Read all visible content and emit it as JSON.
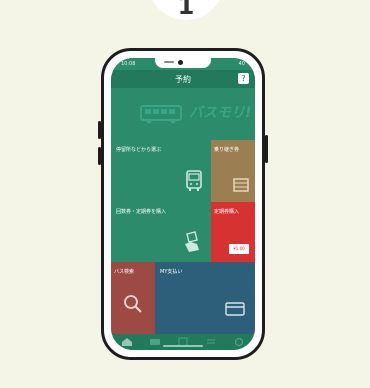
{
  "step": {
    "number": "1"
  },
  "status_bar": {
    "time": "10:08",
    "battery": "40"
  },
  "nav": {
    "title": "予約",
    "help": "?"
  },
  "brand": {
    "name": "バスモリ!"
  },
  "tiles": {
    "search": {
      "label": "停留所などから選ぶ"
    },
    "ticket_book": {
      "label": "乗り継ぎ券"
    },
    "pass_select": {
      "label": "回数券・定期券を購入"
    },
    "pass_buy": {
      "label": "定期券購入",
      "chip": "¥1.00"
    },
    "search2": {
      "label": "バス検索"
    },
    "my_pay": {
      "label": "MY支払い"
    }
  },
  "colors": {
    "background": "#f4f5e6",
    "screen": "#2b8b6b",
    "nav": "#23795c",
    "tile_red": "#d63232",
    "tile_olive": "#9b7f52",
    "tile_dark_red": "#9c4a43",
    "tile_blue": "#2e5f7a"
  },
  "icons": [
    "bus-icon",
    "ticket-icon",
    "hand-icon",
    "search-icon",
    "card-icon",
    "home-icon"
  ]
}
